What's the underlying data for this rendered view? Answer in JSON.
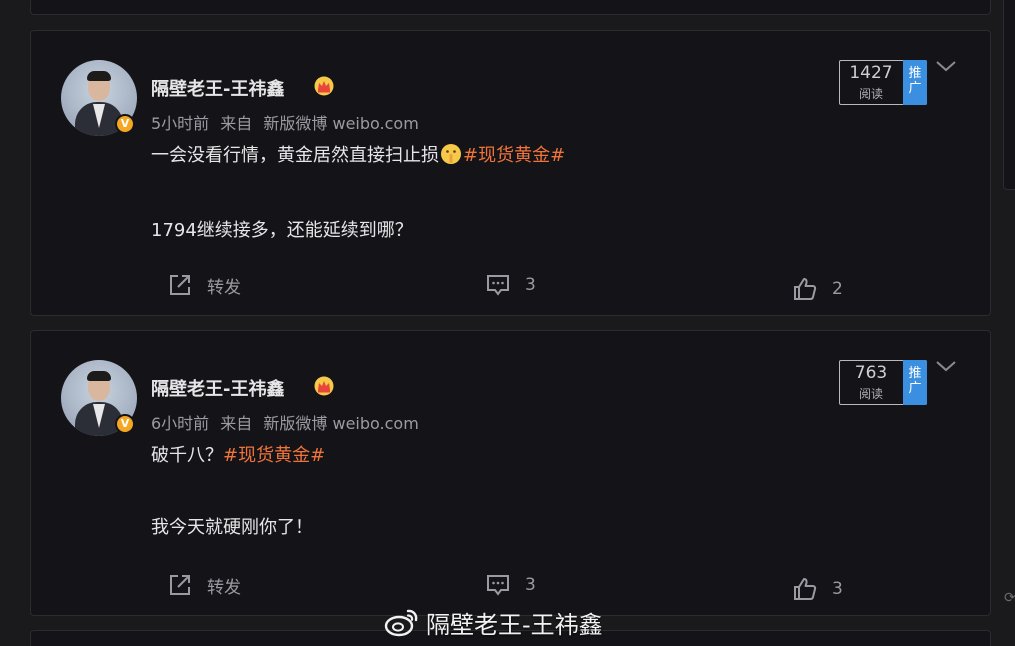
{
  "posts": [
    {
      "author": "隔壁老王-王祎鑫",
      "time": "5小时前",
      "source_prefix": "来自",
      "source": "新版微博 weibo.com",
      "line1_text": "一会没看行情，黄金居然直接扫止损",
      "line1_tag": "#现货黄金#",
      "line2_text": "1794继续接多，还能延续到哪？",
      "read_count": "1427",
      "read_label": "阅读",
      "promo_label": "推广",
      "repost_label": "转发",
      "comment_count": "3",
      "like_count": "2",
      "verified_badge": "V"
    },
    {
      "author": "隔壁老王-王祎鑫",
      "time": "6小时前",
      "source_prefix": "来自",
      "source": "新版微博 weibo.com",
      "line1_text": "破千八？",
      "line1_tag": "#现货黄金#",
      "line2_text": "我今天就硬刚你了！",
      "read_count": "763",
      "read_label": "阅读",
      "promo_label": "推广",
      "repost_label": "转发",
      "comment_count": "3",
      "like_count": "3",
      "verified_badge": "V"
    }
  ],
  "watermark": {
    "text": "隔壁老王-王祎鑫"
  },
  "colors": {
    "background": "#1a1a1d",
    "card": "#141418",
    "hashtag": "#f0743a",
    "promo": "#3b8fe0",
    "verified": "#f5a623"
  },
  "icons": {
    "repost": "share-box-icon",
    "comment": "comment-icon",
    "like": "thumbs-up-icon",
    "menu": "chevron-down-icon",
    "crown": "crown-badge-icon",
    "emoji": "shushing-face-emoji-icon"
  }
}
